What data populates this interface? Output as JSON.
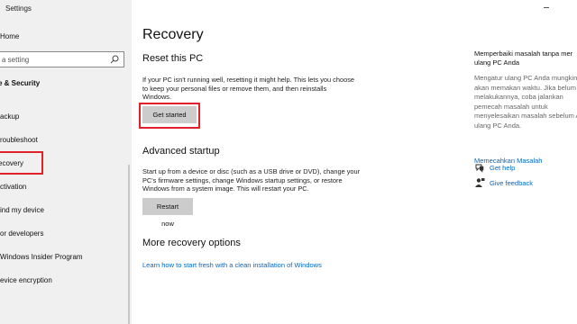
{
  "window": {
    "title": "Settings"
  },
  "sidebar": {
    "home": "Home",
    "search_placeholder": "a setting",
    "section_title": "e & Security",
    "items": [
      {
        "label": "ackup"
      },
      {
        "label": "roubleshoot"
      },
      {
        "label": "ecovery"
      },
      {
        "label": "ctivation"
      },
      {
        "label": "ind my device"
      },
      {
        "label": "or developers"
      },
      {
        "label": "Windows Insider Program"
      },
      {
        "label": "evice encryption"
      }
    ]
  },
  "main": {
    "title": "Recovery",
    "reset": {
      "heading": "Reset this PC",
      "description_lines": [
        "If your PC isn't running well, resetting it might help. This lets you choose",
        "to keep your personal files or remove them, and then reinstalls",
        "Windows."
      ],
      "button": "Get started"
    },
    "advanced": {
      "heading": "Advanced startup",
      "description_lines": [
        "Start up from a device or disc (such as a USB drive or DVD), change your",
        "PC's firmware settings, change Windows startup settings, or restore",
        "Windows from a system image. This will restart your PC."
      ],
      "button": "Restart now"
    },
    "more": {
      "heading": "More recovery options",
      "link": "Learn how to start fresh with a clean installation of Windows"
    }
  },
  "right_panel": {
    "title_lines": [
      "Memperbaiki masalah tanpa mer",
      "ulang PC Anda"
    ],
    "text_lines": [
      "Mengatur ulang PC Anda mungkin",
      "akan memakan waktu. Jika belum",
      "melakukannya, coba jalankan",
      "pemecah masalah untuk",
      "menyelesaikan masalah sebelum A",
      "ulang PC Anda."
    ],
    "troubleshoot_link": "Memecahkan Masalah",
    "get_help": "Get help",
    "give_feedback": "Give feedback"
  },
  "colors": {
    "accent": "#0067c0",
    "highlight": "#e0202a",
    "sidebar_bg": "#f0f0f0",
    "button_bg": "#cccccc"
  },
  "icons": {
    "search": "search-icon",
    "help": "help-chat-icon",
    "feedback": "feedback-person-icon"
  }
}
